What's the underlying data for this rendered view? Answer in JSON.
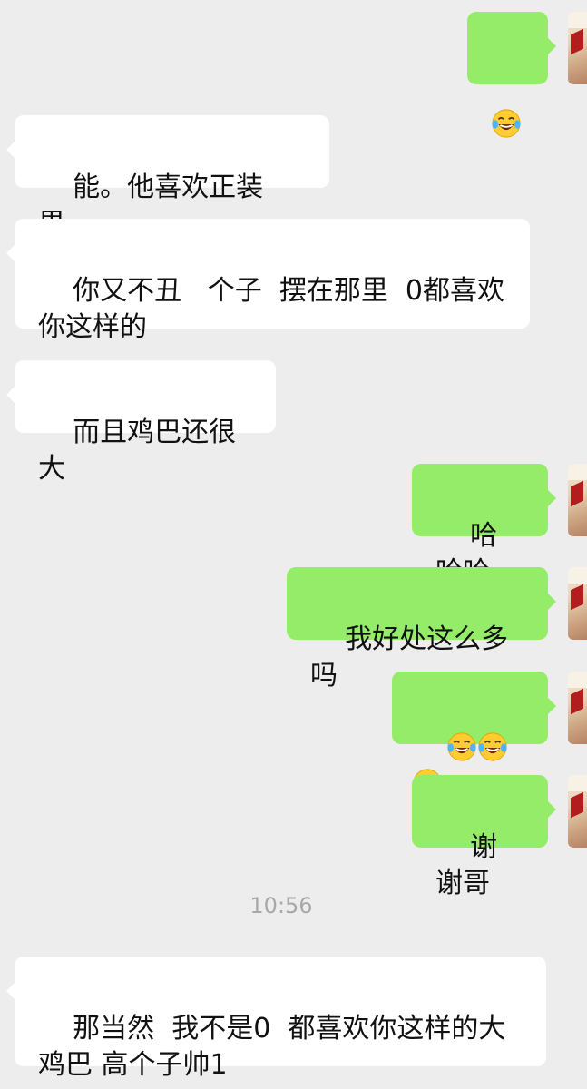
{
  "messages": [
    {
      "side": "out",
      "type": "emoji",
      "emoji": "tears-of-joy",
      "count": 1
    },
    {
      "side": "in",
      "text": "能。他喜欢正装男。"
    },
    {
      "side": "in",
      "text": "你又不丑   个子  摆在那里  0都喜欢你这样的"
    },
    {
      "side": "in",
      "text": "而且鸡巴还很大"
    },
    {
      "side": "out",
      "text": "哈哈哈"
    },
    {
      "side": "out",
      "text": "我好处这么多吗"
    },
    {
      "side": "out",
      "type": "emoji",
      "emoji": "tears-of-joy",
      "count": 3
    },
    {
      "side": "out",
      "text": "谢谢哥"
    },
    {
      "side": "in",
      "text": "那当然  我不是0  都喜欢你这样的大鸡巴 高个子帅1"
    }
  ],
  "timestamp": "10:56",
  "colors": {
    "background": "#ededed",
    "incoming_bubble": "#ffffff",
    "outgoing_bubble": "#95ec69",
    "timestamp": "#a8a8a8"
  }
}
